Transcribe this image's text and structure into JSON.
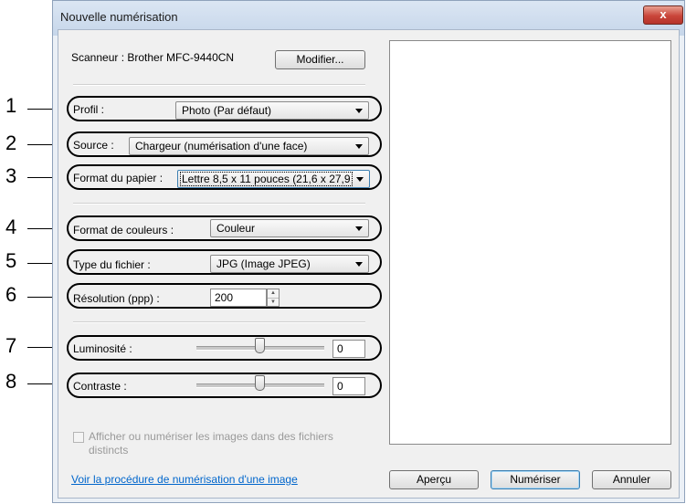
{
  "window": {
    "title": "Nouvelle numérisation",
    "close_label": "x"
  },
  "scanner": {
    "label": "Scanneur : Brother MFC-9440CN",
    "modify_button": "Modifier..."
  },
  "callouts": [
    "1",
    "2",
    "3",
    "4",
    "5",
    "6",
    "7",
    "8"
  ],
  "profile": {
    "label": "Profil :",
    "value": "Photo (Par défaut)"
  },
  "source": {
    "label": "Source :",
    "value": "Chargeur (numérisation d'une face)"
  },
  "paper": {
    "label": "Format du papier :",
    "value": "Lettre 8,5 x 11 pouces (21,6 x 27,9"
  },
  "color": {
    "label": "Format de couleurs :",
    "value": "Couleur"
  },
  "filetype": {
    "label": "Type du fichier :",
    "value": "JPG (Image JPEG)"
  },
  "resolution": {
    "label": "Résolution (ppp) :",
    "value": "200"
  },
  "brightness": {
    "label": "Luminosité :",
    "value": "0",
    "level": 0.5
  },
  "contrast": {
    "label": "Contraste :",
    "value": "0",
    "level": 0.5
  },
  "separate_files": {
    "label_line1": "Afficher ou numériser les images dans des fichiers",
    "label_line2": "distincts",
    "checked": false
  },
  "help_link": "Voir la procédure de numérisation d'une image",
  "buttons": {
    "preview": "Aperçu",
    "scan": "Numériser",
    "cancel": "Annuler"
  }
}
